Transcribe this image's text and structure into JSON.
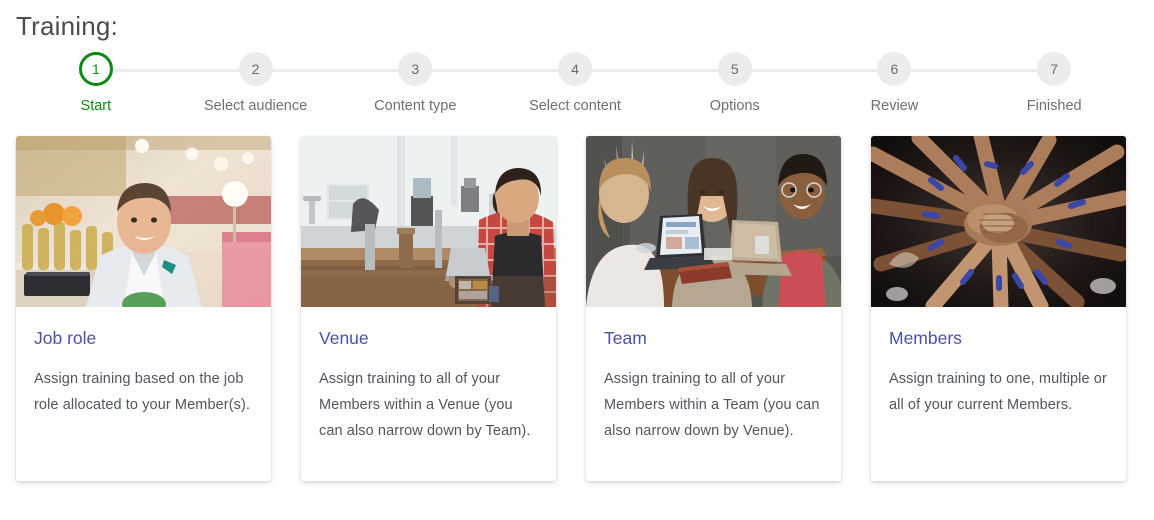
{
  "page": {
    "title": "Training:"
  },
  "stepper": {
    "active_index": 0,
    "active_color": "#0b8a16",
    "inactive_circle_color": "#ececec",
    "inactive_label_color": "#6f6f6f",
    "track_color": "#ececec",
    "steps": [
      {
        "number": "1",
        "label": "Start"
      },
      {
        "number": "2",
        "label": "Select audience"
      },
      {
        "number": "3",
        "label": "Content type"
      },
      {
        "number": "4",
        "label": "Select content"
      },
      {
        "number": "5",
        "label": "Options"
      },
      {
        "number": "6",
        "label": "Review"
      },
      {
        "number": "7",
        "label": "Finished"
      }
    ]
  },
  "cards": {
    "title_color": "#4b51a6",
    "text_color": "#51565c",
    "items": [
      {
        "title": "Job role",
        "text": "Assign training based on the job role allocated to your Member(s).",
        "image_name": "photo-man-in-white-blazer-at-restaurant-bar"
      },
      {
        "title": "Venue",
        "text": "Assign training to all of your Members within a Venue (you can also narrow down by Team).",
        "image_name": "photo-barista-in-red-plaid-shirt-at-cafe-counter"
      },
      {
        "title": "Team",
        "text": "Assign training to all of your Members within a Team (you can also narrow down by Venue).",
        "image_name": "photo-three-colleagues-laughing-with-laptops-at-table"
      },
      {
        "title": "Members",
        "text": "Assign training to one, multiple or all of your current Members.",
        "image_name": "photo-many-hands-stacked-in-circle-with-blue-wristbands"
      }
    ]
  }
}
